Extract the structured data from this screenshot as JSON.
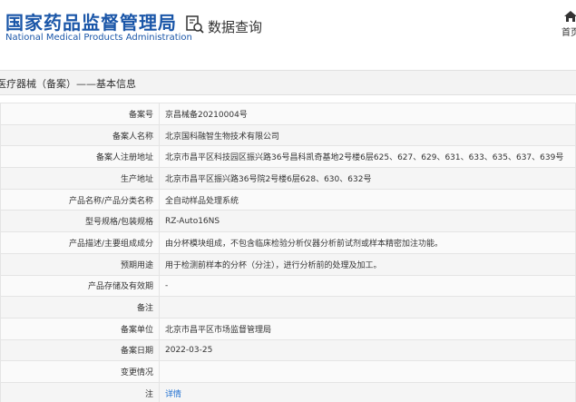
{
  "header": {
    "logo_cn": "国家药品监督管理局",
    "logo_en": "National Medical Products Administration",
    "query_icon": "search-document-icon",
    "query_label": "数据查询",
    "home_icon": "home-icon",
    "home_label": "首页"
  },
  "title": "医疗器械（备案）——基本信息",
  "rows": [
    {
      "label": "备案号",
      "value": "京昌械备20210004号"
    },
    {
      "label": "备案人名称",
      "value": "北京国科融智生物技术有限公司"
    },
    {
      "label": "备案人注册地址",
      "value": "北京市昌平区科技园区振兴路36号昌科凯奇基地2号楼6层625、627、629、631、633、635、637、639号"
    },
    {
      "label": "生产地址",
      "value": "北京市昌平区振兴路36号院2号楼6层628、630、632号"
    },
    {
      "label": "产品名称/产品分类名称",
      "value": "全自动样品处理系统"
    },
    {
      "label": "型号规格/包装规格",
      "value": "RZ-Auto16NS"
    },
    {
      "label": "产品描述/主要组成成分",
      "value": "由分杯模块组成，不包含临床检验分析仪器分析前试剂或样本精密加注功能。"
    },
    {
      "label": "预期用途",
      "value": "用于检测前样本的分杯（分注），进行分析前的处理及加工。"
    },
    {
      "label": "产品存储及有效期",
      "value": "-"
    },
    {
      "label": "备注",
      "value": ""
    },
    {
      "label": "备案单位",
      "value": "北京市昌平区市场监督管理局"
    },
    {
      "label": "备案日期",
      "value": "2022-03-25"
    },
    {
      "label": "变更情况",
      "value": ""
    },
    {
      "label": "注",
      "value": "详情"
    }
  ]
}
